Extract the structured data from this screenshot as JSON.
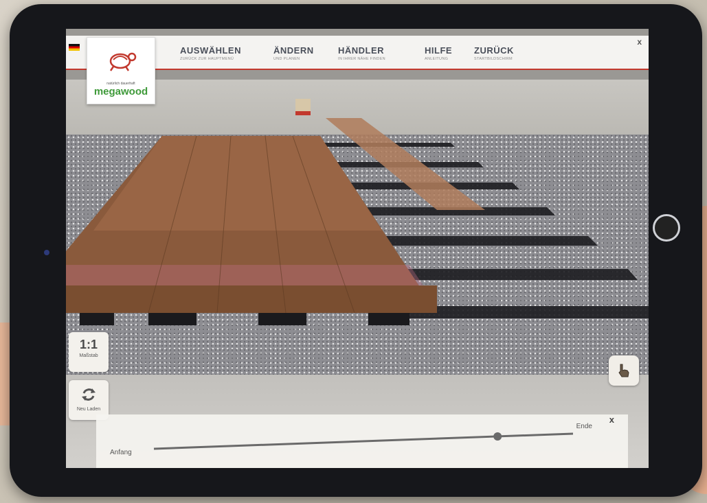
{
  "nav": {
    "items": [
      {
        "title": "AUSWÄHLEN",
        "sub": "ZURÜCK ZUR HAUPTMENÜ"
      },
      {
        "title": "ÄNDERN",
        "sub": "UND PLANEN"
      },
      {
        "title": "HÄNDLER",
        "sub": "IN IHRER NÄHE FINDEN"
      },
      {
        "title": "HILFE",
        "sub": "ANLEITUNG"
      },
      {
        "title": "ZURÜCK",
        "sub": "STARTBILDSCHIRM"
      }
    ],
    "close": "x"
  },
  "logo": {
    "brand": "megawood",
    "tagline": "natürlich dauerhaft"
  },
  "side_buttons": {
    "scale": {
      "value": "1:1",
      "label": "Maßstab"
    },
    "reload": {
      "label": "Neu Laden"
    }
  },
  "timeline": {
    "start_label": "Anfang",
    "end_label": "Ende",
    "close": "x",
    "progress": 0.82
  },
  "colors": {
    "accent": "#c2392e",
    "brand_green": "#3f9a3a"
  }
}
